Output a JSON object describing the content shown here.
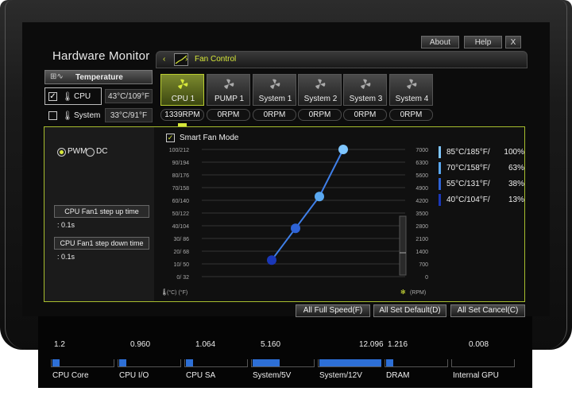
{
  "app": {
    "title": "Hardware Monitor"
  },
  "top_buttons": [
    {
      "label": "About"
    },
    {
      "label": "Help"
    },
    {
      "label": "X"
    }
  ],
  "fan_control_tab": {
    "label": "Fan Control"
  },
  "temperature": {
    "heading": "Temperature",
    "rows": [
      {
        "name": "CPU",
        "value": "43°C/109°F",
        "checked": true
      },
      {
        "name": "System",
        "value": "33°C/91°F",
        "checked": false
      }
    ]
  },
  "fans": [
    {
      "name": "CPU 1",
      "rpm": "1339RPM",
      "active": true
    },
    {
      "name": "PUMP 1",
      "rpm": "0RPM",
      "active": false
    },
    {
      "name": "System 1",
      "rpm": "0RPM",
      "active": false
    },
    {
      "name": "System 2",
      "rpm": "0RPM",
      "active": false
    },
    {
      "name": "System 3",
      "rpm": "0RPM",
      "active": false
    },
    {
      "name": "System 4",
      "rpm": "0RPM",
      "active": false
    }
  ],
  "mode": {
    "pwm_label": "PWM",
    "dc_label": "DC",
    "selected": "PWM"
  },
  "step": {
    "up_label": "CPU Fan1 step up time",
    "up_value": ": 0.1s",
    "down_label": "CPU Fan1 step down time",
    "down_value": ": 0.1s"
  },
  "smart_fan": {
    "label": "Smart Fan Mode",
    "checked": true
  },
  "chart_data": {
    "type": "line",
    "y_left_ticks": [
      "100/212",
      "90/194",
      "80/176",
      "70/158",
      "60/140",
      "50/122",
      "40/104",
      "30/ 86",
      "20/ 68",
      "10/ 50",
      "0/ 32"
    ],
    "y_right_ticks": [
      "7000",
      "6300",
      "5600",
      "4900",
      "4200",
      "3500",
      "2800",
      "2100",
      "1400",
      "700",
      "0"
    ],
    "x_label_left": "(°C) (°F)",
    "x_label_right": "(RPM)",
    "ylim": [
      0,
      100
    ],
    "series": [
      {
        "x": [
          40,
          55,
          70,
          85
        ],
        "y": [
          13,
          38,
          63,
          100
        ]
      }
    ]
  },
  "legend": [
    {
      "temp": "85°C/185°F/",
      "pct": "100%",
      "color": "#7fc6ff"
    },
    {
      "temp": "70°C/158°F/",
      "pct": "63%",
      "color": "#5aa8f0"
    },
    {
      "temp": "55°C/131°F/",
      "pct": "38%",
      "color": "#2e63d6"
    },
    {
      "temp": "40°C/104°F/",
      "pct": "13%",
      "color": "#1a37b8"
    }
  ],
  "bottom_buttons": [
    {
      "label": "All Full Speed(F)"
    },
    {
      "label": "All Set Default(D)"
    },
    {
      "label": "All Set Cancel(C)"
    }
  ],
  "voltages": [
    {
      "label": "CPU Core",
      "value": "1.2",
      "level": 0.12
    },
    {
      "label": "CPU I/O",
      "value": "0.960",
      "level": 0.1
    },
    {
      "label": "CPU SA",
      "value": "1.064",
      "level": 0.1
    },
    {
      "label": "System/5V",
      "value": "5.160",
      "level": 0.43
    },
    {
      "label": "System/12V",
      "value": "12.096",
      "level": 1.0
    },
    {
      "label": "DRAM",
      "value": "1.216",
      "level": 0.12
    },
    {
      "label": "Internal GPU",
      "value": "0.008",
      "level": 0.0
    }
  ]
}
